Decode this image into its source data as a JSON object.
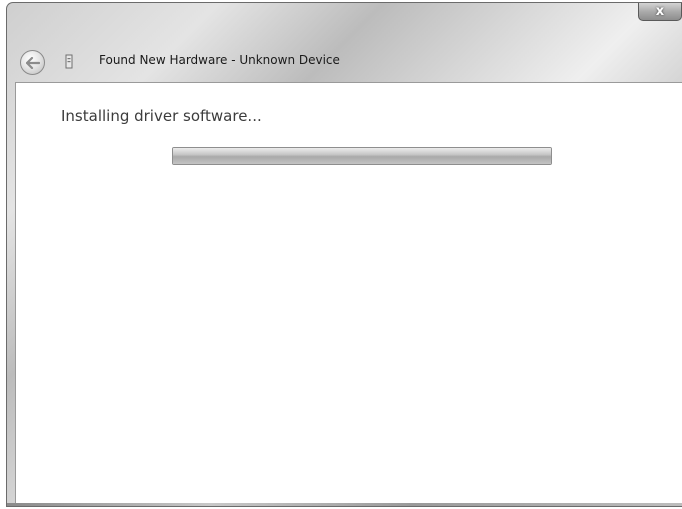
{
  "window": {
    "title": "Found New Hardware - Unknown Device",
    "close_label": "x"
  },
  "icons": {
    "back": "back-arrow-icon",
    "device": "device-icon",
    "close": "close-icon"
  },
  "content": {
    "status_text": "Installing driver software...",
    "progress_fraction": 1.0
  },
  "colors": {
    "content_background": "#ffffff",
    "progress_fill": "#b8b8b8"
  }
}
